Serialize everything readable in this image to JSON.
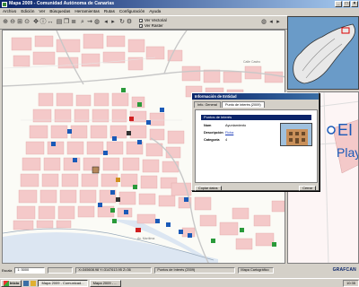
{
  "window": {
    "title": "Mapa 2009 - Comunidad Autónoma de Canarias",
    "buttons": [
      "_",
      "□",
      "×"
    ]
  },
  "menu": [
    "Archivo",
    "Edición",
    "Ver",
    "Búsquedas",
    "Herramientas",
    "Rutas",
    "Configuración",
    "Ayuda"
  ],
  "toolbar": {
    "icons": [
      "zoom-in-icon",
      "zoom-out-icon",
      "zoom-window-icon",
      "zoom-full-icon",
      "pan-icon",
      "info-icon",
      "measure-icon",
      "print-icon",
      "copy-icon",
      "layers-icon",
      "search-icon",
      "route-icon",
      "globe-icon",
      "back-icon",
      "forward-icon",
      "refresh-icon",
      "settings-icon"
    ],
    "checkbox1": "Ver Vectorial",
    "checkbox2": "Ver Raster",
    "right_icons": [
      "globe-icon",
      "arrow-left-icon",
      "arrow-right-icon",
      "folder-icon"
    ]
  },
  "map": {
    "street_labels": [
      "Barranco",
      "Puerto",
      "Calle Castro",
      "Av. Marítima"
    ],
    "inset_label": "Playa",
    "inset_partial": "EI"
  },
  "dialog": {
    "title": "Información de Entidad",
    "tabs": [
      "Info. General",
      "Punto de interés (2009)"
    ],
    "section": "Puntos de interés",
    "rows": [
      {
        "label": "Nom",
        "value": "Ayuntamiento"
      },
      {
        "label": "Descripción",
        "value": "Ficha"
      },
      {
        "label": "Categoría",
        "value": "4"
      }
    ],
    "copy_button": "Copiar datos",
    "close_button": "Cerrar"
  },
  "statusbar": {
    "scale_label": "Escala",
    "scale_value": "1: 5000",
    "coords": "X=345608.98  Y=3147613.95  Z=36",
    "mode": "Puntos de Interés (2009)",
    "status": "Mapa Cartográfico"
  },
  "brand": "GRAFCAN",
  "taskbar": {
    "start": "Inicio",
    "items": [
      "Mapa 2009 - Comunicad...",
      "Mapa 2009 - ..."
    ],
    "clock": "10:35"
  },
  "colors": {
    "block": "#f4c9c9",
    "road": "#ffffff",
    "sea": "#dce6f2",
    "title": "#0a246a"
  }
}
